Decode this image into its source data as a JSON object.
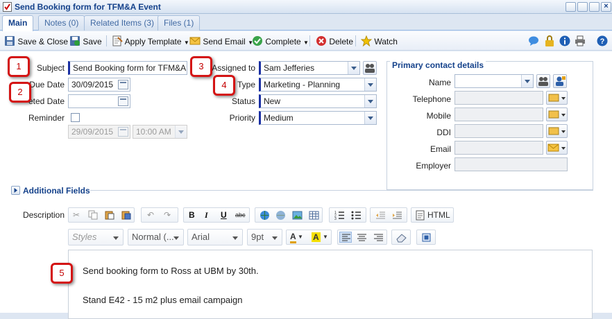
{
  "window": {
    "title": "Send Booking form for TFM&A Event"
  },
  "tabs": [
    {
      "label": "Main"
    },
    {
      "label": "Notes (0)"
    },
    {
      "label": "Related Items (3)"
    },
    {
      "label": "Files (1)"
    }
  ],
  "toolbar": {
    "save_close": "Save & Close",
    "save": "Save",
    "apply_template": "Apply Template",
    "send_email": "Send Email",
    "complete": "Complete",
    "delete": "Delete",
    "watch": "Watch"
  },
  "form": {
    "subject_label": "Subject",
    "subject_value": "Send Booking form for TFM&A Event",
    "due_date_label": "Due Date",
    "due_date_value": "30/09/2015",
    "completed_date_label": "eted Date",
    "completed_date_value": "",
    "reminder_label": "Reminder",
    "reminder_date": "29/09/2015",
    "reminder_time": "10:00 AM",
    "assigned_label": "Assigned to",
    "assigned_value": "Sam Jefferies",
    "type_label": "Type",
    "type_value": "Marketing - Planning",
    "status_label": "Status",
    "status_value": "New",
    "priority_label": "Priority",
    "priority_value": "Medium"
  },
  "contact": {
    "title": "Primary contact details",
    "name_label": "Name",
    "telephone_label": "Telephone",
    "mobile_label": "Mobile",
    "ddi_label": "DDI",
    "email_label": "Email",
    "employer_label": "Employer"
  },
  "additional": {
    "title": "Additional Fields"
  },
  "description": {
    "label": "Description",
    "html_label": "HTML",
    "styles": "Styles",
    "format": "Normal (...",
    "font": "Arial",
    "size": "9pt",
    "line1": "Send booking form to Ross at UBM by 30th.",
    "line2": "Stand E42 - 15 m2 plus email campaign"
  },
  "callouts": [
    "1",
    "2",
    "3",
    "4",
    "5"
  ]
}
